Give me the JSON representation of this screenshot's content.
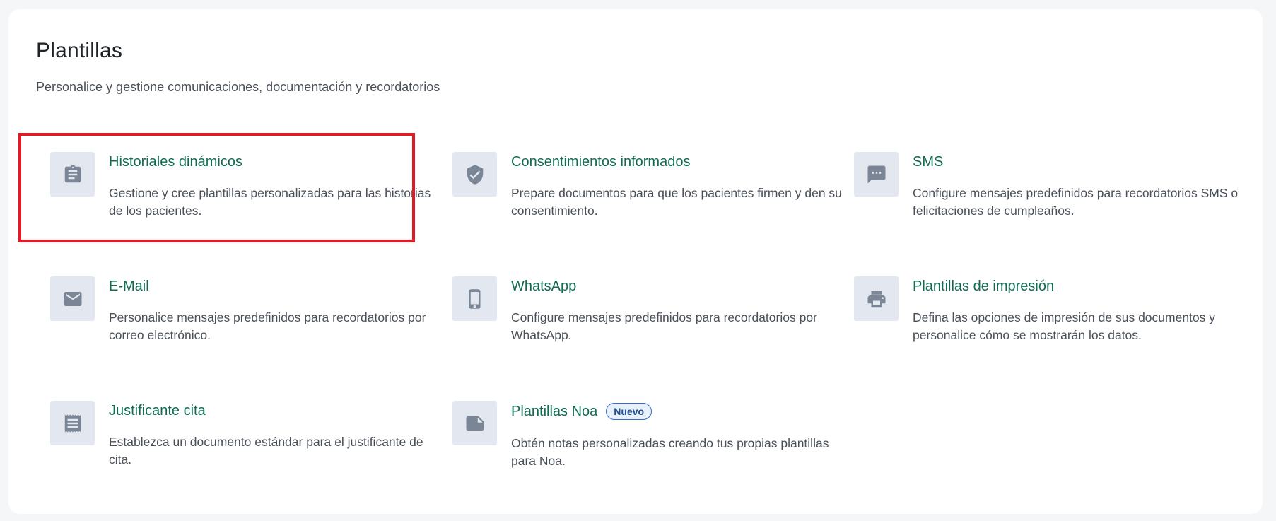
{
  "page": {
    "title": "Plantillas",
    "subtitle": "Personalice y gestione comunicaciones, documentación y recordatorios"
  },
  "cards": [
    {
      "title": "Historiales dinámicos",
      "description": "Gestione y cree plantillas personalizadas para las historias de los pacientes.",
      "icon": "clipboard-icon"
    },
    {
      "title": "Consentimientos informados",
      "description": "Prepare documentos para que los pacientes firmen y den su consentimiento.",
      "icon": "shield-check-icon"
    },
    {
      "title": "SMS",
      "description": "Configure mensajes predefinidos para recordatorios SMS o felicitaciones de cumpleaños.",
      "icon": "sms-icon"
    },
    {
      "title": "E-Mail",
      "description": "Personalice mensajes predefinidos para recordatorios por correo electrónico.",
      "icon": "mail-icon"
    },
    {
      "title": "WhatsApp",
      "description": "Configure mensajes predefinidos para recordatorios por WhatsApp.",
      "icon": "smartphone-icon"
    },
    {
      "title": "Plantillas de impresión",
      "description": "Defina las opciones de impresión de sus documentos y personalice cómo se mostrarán los datos.",
      "icon": "printer-icon"
    },
    {
      "title": "Justificante cita",
      "description": "Establezca un documento estándar para el justificante de cita.",
      "icon": "receipt-icon"
    },
    {
      "title": "Plantillas Noa",
      "badge": "Nuevo",
      "description": "Obtén notas personalizadas creando tus propias plantillas para Noa.",
      "icon": "note-icon"
    }
  ],
  "colors": {
    "title_green": "#0f6b52",
    "icon_box": "#e3e8f0",
    "icon": "#7a8696",
    "highlight_red": "#e01b24",
    "badge_blue": "#2f6fc2"
  }
}
